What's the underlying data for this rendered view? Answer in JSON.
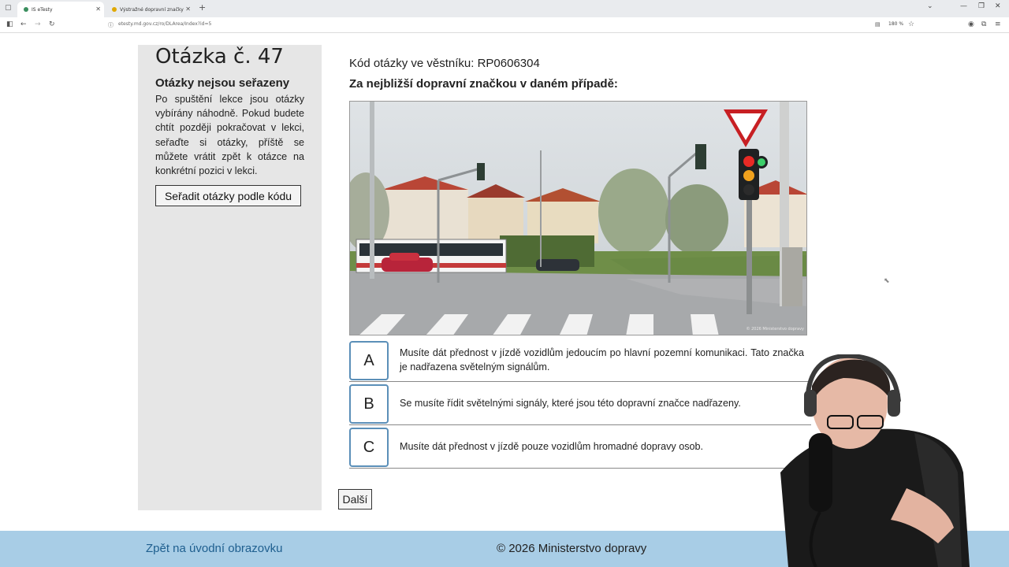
{
  "browser": {
    "tabs": [
      {
        "title": "IS eTesty",
        "favicon_color": "#3a8e5e",
        "active": true
      },
      {
        "title": "Výstražné dopravní značky",
        "favicon_color": "#e0a800",
        "active": false
      }
    ],
    "url": "etesty.md.gov.cz/ro/DLArea/Index?id=5",
    "zoom": "180 %"
  },
  "sidebar": {
    "question_title": "Otázka č. 47",
    "heading": "Otázky nejsou seřazeny",
    "paragraph": "Po spuštění lekce jsou otázky vybírány náhodně. Pokud budete chtít později pokračovat v lekci, seřaďte si otázky, příště se můžete vrátit zpět k otázce na konkrétní pozici v lekci.",
    "sort_button": "Seřadit otázky podle kódu"
  },
  "main": {
    "code_line": "Kód otázky ve věstníku: RP0606304",
    "question": "Za nejbližší dopravní značkou v daném případě:",
    "photo_watermark": "© 2026 Ministerstvo dopravy",
    "answers": [
      {
        "letter": "A",
        "text": "Musíte dát přednost v jízdě vozidlům jedoucím po hlavní pozemní komunikaci. Tato značka je nadřazena světelným signálům."
      },
      {
        "letter": "B",
        "text": "Se musíte řídit světelnými signály, které jsou této dopravní značce nadřazeny."
      },
      {
        "letter": "C",
        "text": "Musíte dát přednost v jízdě pouze vozidlům hromadné dopravy osob."
      }
    ],
    "next_button": "Další"
  },
  "footer": {
    "back_link": "Zpět na úvodní obrazovku",
    "copyright": "© 2026 Ministerstvo dopravy"
  },
  "colors": {
    "sidebar_bg": "#e6e6e6",
    "footer_bg": "#a8cde6",
    "answer_border": "#5b8fb8",
    "link": "#1f5f8f"
  }
}
